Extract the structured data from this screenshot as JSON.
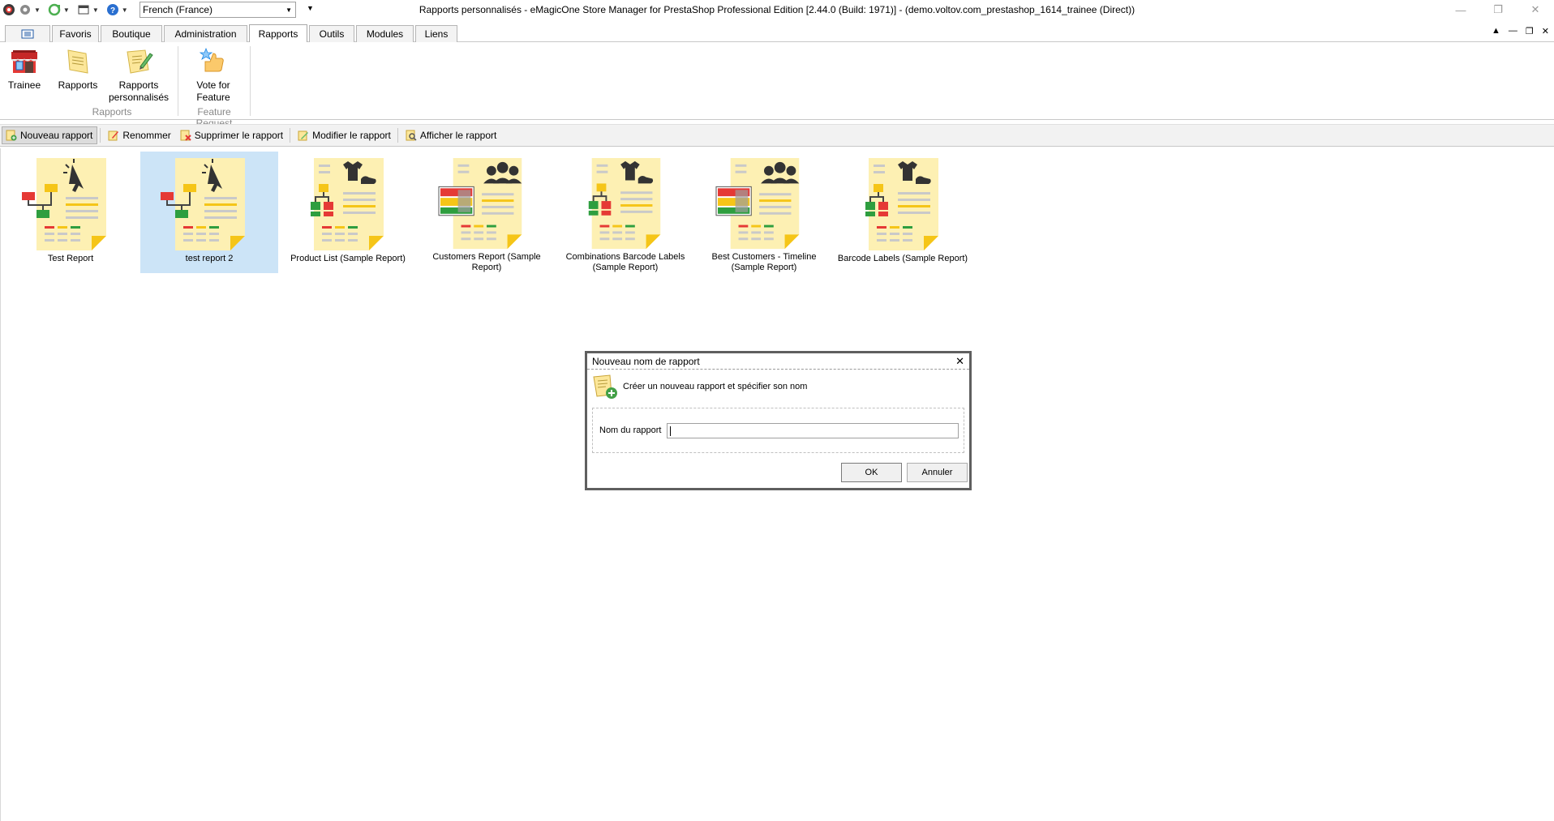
{
  "window": {
    "title": "Rapports personnalisés - eMagicOne Store Manager for PrestaShop Professional Edition [2.44.0 (Build: 1971)] - (demo.voltov.com_prestashop_1614_trainee (Direct))",
    "language_select": "French (France)"
  },
  "tabs": [
    "Favoris",
    "Boutique",
    "Administration",
    "Rapports",
    "Outils",
    "Modules",
    "Liens"
  ],
  "active_tab": "Rapports",
  "ribbon": {
    "trainee": "Trainee",
    "rapports": "Rapports",
    "rapports_perso_line1": "Rapports",
    "rapports_perso_line2": "personnalisés",
    "vote_line1": "Vote for",
    "vote_line2": "Feature",
    "group_rapports": "Rapports",
    "group_feature": "Feature Request"
  },
  "toolbar": {
    "nouveau": "Nouveau rapport",
    "renommer": "Renommer",
    "supprimer": "Supprimer le rapport",
    "modifier": "Modifier le rapport",
    "afficher": "Afficher le rapport"
  },
  "reports": [
    {
      "label": "Test Report",
      "icon": "report-flow-icon"
    },
    {
      "label": "test report 2",
      "icon": "report-flow-icon",
      "selected": true
    },
    {
      "label": "Product List (Sample Report)",
      "icon": "report-product-icon"
    },
    {
      "label": "Customers Report (Sample Report)",
      "icon": "report-customers-icon"
    },
    {
      "label": "Combinations Barcode Labels (Sample Report)",
      "icon": "report-product-icon"
    },
    {
      "label": "Best Customers - Timeline (Sample Report)",
      "icon": "report-customers-icon"
    },
    {
      "label": "Barcode Labels (Sample Report)",
      "icon": "report-product-icon"
    }
  ],
  "dialog": {
    "title": "Nouveau nom de rapport",
    "header": "Créer un nouveau rapport et spécifier son nom",
    "field_label": "Nom du rapport",
    "field_value": "",
    "ok": "OK",
    "cancel": "Annuler"
  },
  "colors": {
    "selected_bg": "#cce4f7",
    "doc_yellow": "#fdf0b3",
    "accent_red": "#e53935",
    "accent_green": "#2e9e3f",
    "accent_yellow": "#f5c518"
  }
}
